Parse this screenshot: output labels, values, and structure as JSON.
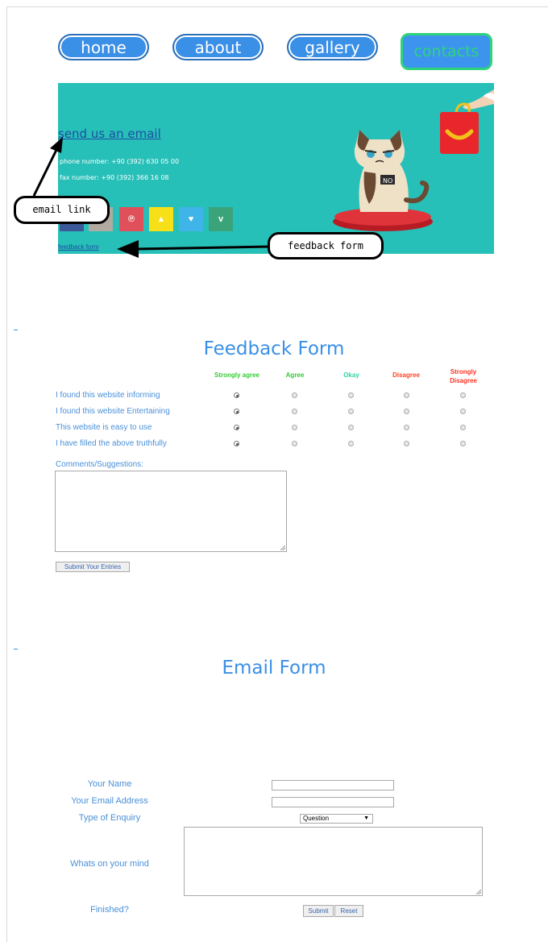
{
  "nav": {
    "items": [
      {
        "label": "home"
      },
      {
        "label": "about"
      },
      {
        "label": "gallery"
      },
      {
        "label": "contacts"
      }
    ]
  },
  "banner": {
    "email_link": "send us an email",
    "phone": "phone number: +90 (392) 630 05 00",
    "fax": "fax number: +90 (392) 366 16 08",
    "social": [
      {
        "icon": "facebook-icon",
        "glyph": "f",
        "color": "#3b5998"
      },
      {
        "icon": "instagram-icon",
        "glyph": "◎",
        "color": "#b0aaa0"
      },
      {
        "icon": "pinterest-icon",
        "glyph": "℗",
        "color": "#e0505a"
      },
      {
        "icon": "snapchat-icon",
        "glyph": "▲",
        "color": "#f7e017"
      },
      {
        "icon": "twitter-icon",
        "glyph": "♥",
        "color": "#3fb4e8"
      },
      {
        "icon": "vine-icon",
        "glyph": "v",
        "color": "#3aa37a"
      }
    ],
    "cat_sign": "NO",
    "feedback_link": "feedback form",
    "bg_color": "#27c0b8"
  },
  "annotations": {
    "email_callout": "email link",
    "feedback_callout": "feedback form"
  },
  "feedback": {
    "title": "Feedback Form",
    "columns": [
      {
        "label": "Strongly agree",
        "color": "#33cc33"
      },
      {
        "label": "Agree",
        "color": "#33cc33"
      },
      {
        "label": "Okay",
        "color": "#2ed4a6"
      },
      {
        "label": "Disagree",
        "color": "#ff4422"
      },
      {
        "label": "Strongly Disagree",
        "color": "#ff3322"
      }
    ],
    "questions": [
      {
        "label": "I found this website informing",
        "selected": 0
      },
      {
        "label": "I found this website Entertaining",
        "selected": 0
      },
      {
        "label": "This website is easy to use",
        "selected": 0
      },
      {
        "label": "I have filled the above truthfully",
        "selected": 0
      }
    ],
    "comments_label": "Comments/Suggestions:",
    "submit_label": "Submit Your Entries"
  },
  "email_form": {
    "title": "Email Form",
    "name_label": "Your Name",
    "email_label": "Your Email Address",
    "enquiry_label": "Type of Enquiry",
    "enquiry_selected": "Question",
    "mind_label": "Whats on your mind",
    "finished_label": "Finished?",
    "submit_label": "Submit",
    "reset_label": "Reset"
  }
}
